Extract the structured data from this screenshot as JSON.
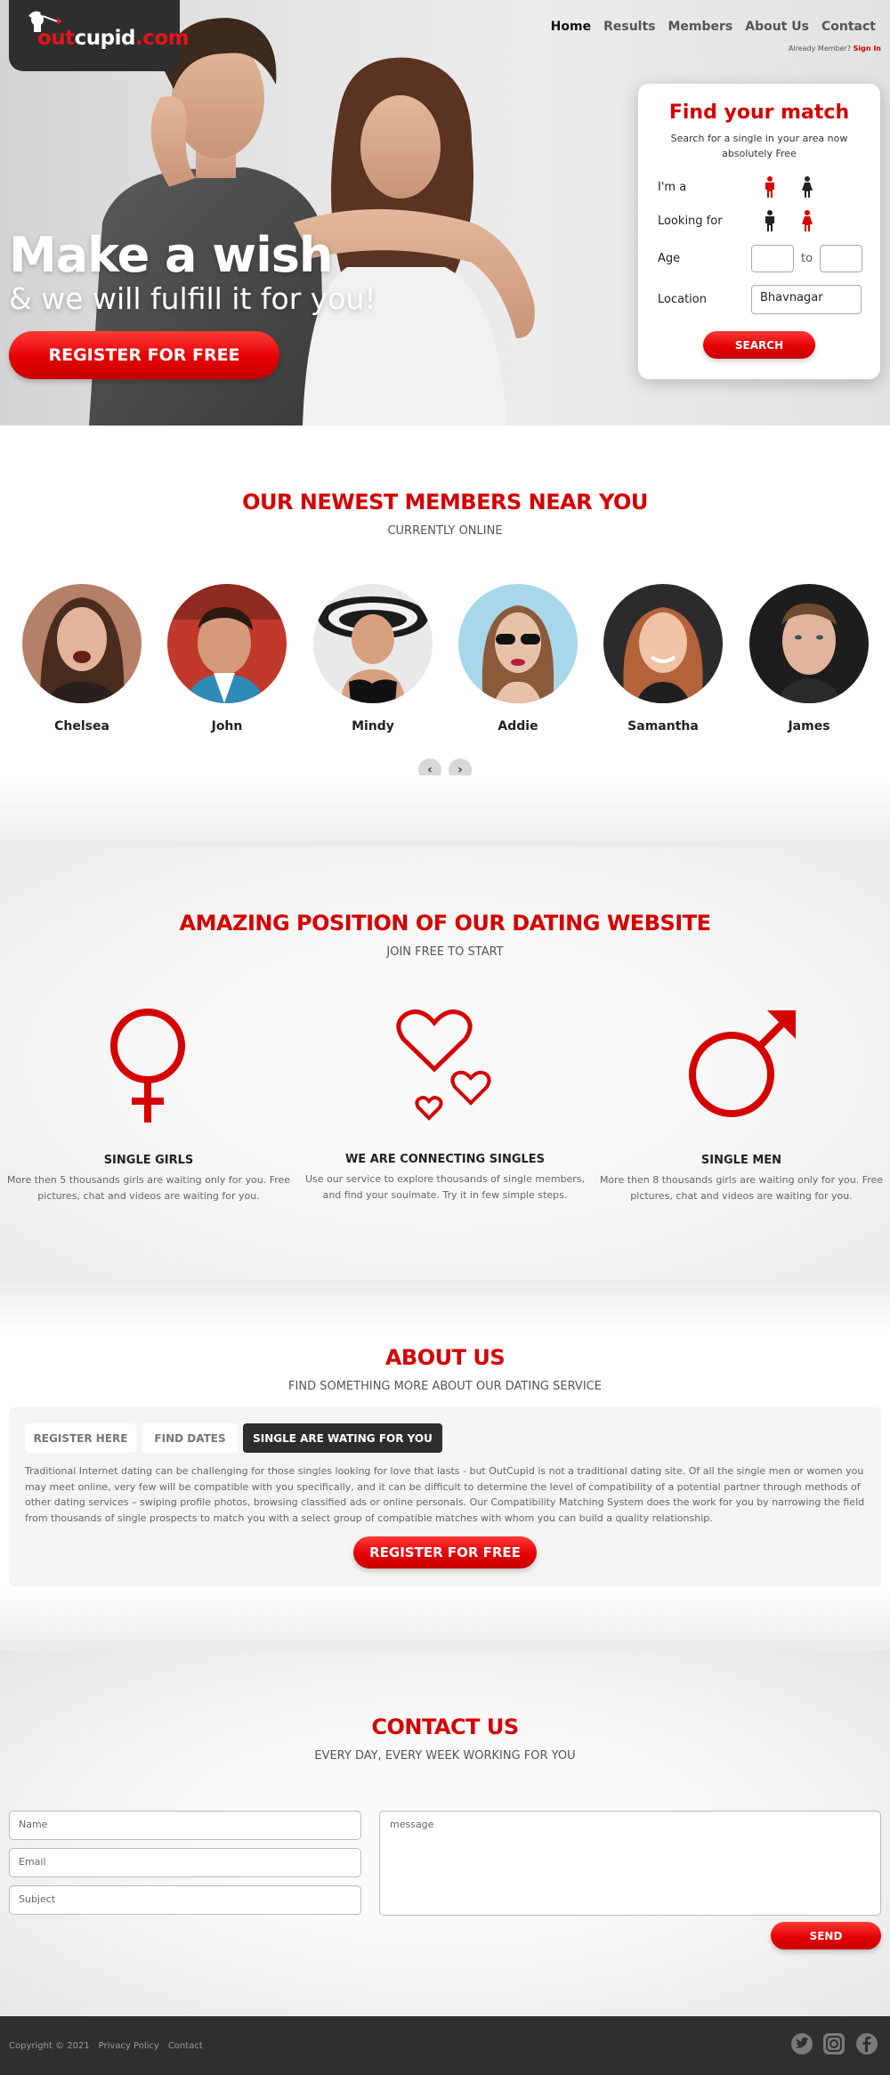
{
  "brand": {
    "logo_text_dark": "out",
    "logo_text_cupid": "cupid",
    "logo_text_com": ".com"
  },
  "nav": {
    "items": [
      "Home",
      "Results",
      "Members",
      "About Us",
      "Contact"
    ],
    "already_member": "Already Member?",
    "sign_in": "Sign In"
  },
  "hero": {
    "headline": "Make a wish",
    "subheadline": "& we will fulfill it for you!",
    "register_label": "REGISTER FOR FREE"
  },
  "find_match": {
    "title": "Find your match",
    "subtitle": "Search for a single in your area now absolutely Free",
    "im_a_label": "I'm a",
    "looking_for_label": "Looking for",
    "age_label": "Age",
    "age_to": "to",
    "location_label": "Location",
    "location_value": "Bhavnagar",
    "search_label": "SEARCH"
  },
  "members_section": {
    "title": "OUR NEWEST MEMBERS NEAR YOU",
    "subtitle": "CURRENTLY ONLINE",
    "members": [
      "Chelsea",
      "John",
      "Mindy",
      "Addie",
      "Samantha",
      "James"
    ]
  },
  "amazing_section": {
    "title": "AMAZING POSITION OF OUR DATING WEBSITE",
    "subtitle": "JOIN FREE TO START",
    "features": [
      {
        "title": "SINGLE GIRLS",
        "desc": "More then 5 thousands girls are waiting only for you. Free pictures, chat and videos are waiting for you."
      },
      {
        "title": "WE ARE CONNECTING SINGLES",
        "desc": "Use our service to explore thousands of single members, and find your soulmate. Try it in few simple steps."
      },
      {
        "title": "SINGLE MEN",
        "desc": "More then 8 thousands girls are waiting only for you. Free pictures, chat and videos are waiting for you."
      }
    ]
  },
  "about_section": {
    "title": "ABOUT US",
    "subtitle": "FIND SOMETHING MORE ABOUT OUR DATING SERVICE",
    "tabs": [
      "REGISTER HERE",
      "FIND DATES",
      "SINGLE ARE WATING FOR YOU"
    ],
    "text": "Traditional Internet dating can be challenging for those singles looking for love that lasts - but OutCupid is not a traditional dating site. Of all the single men or women you may meet online, very few will be compatible with you specifically, and it can be difficult to determine the level of compatibility of a potential partner through methods of other dating services – swiping profile photos, browsing classified ads or online personals. Our Compatibility Matching System does the work for you by narrowing the field from thousands of single prospects to match you with a select group of compatible matches with whom you can build a quality relationship.",
    "register_label": "REGISTER FOR FREE"
  },
  "contact_section": {
    "title": "CONTACT US",
    "subtitle": "EVERY DAY, EVERY WEEK WORKING FOR YOU",
    "name_placeholder": "Name",
    "email_placeholder": "Email",
    "subject_placeholder": "Subject",
    "message_placeholder": "message",
    "send_label": "SEND"
  },
  "footer": {
    "copyright": "Copyright © 2021",
    "privacy": "Privacy Policy",
    "contact": "Contact"
  },
  "colors": {
    "brand_red": "#d50000",
    "dark": "#2f2f2f"
  }
}
